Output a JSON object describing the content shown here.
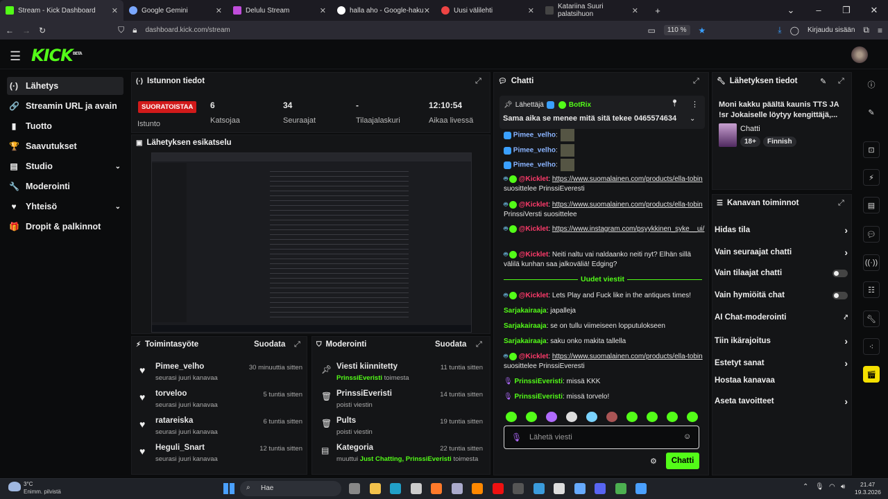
{
  "browser": {
    "tabs": [
      {
        "label": "Stream - Kick Dashboard",
        "color": "#53fc18"
      },
      {
        "label": "Google Gemini",
        "color": "#7aa7ff"
      },
      {
        "label": "Delulu Stream",
        "color": "#c04ddb"
      },
      {
        "label": "halla aho - Google-haku",
        "color": "#ffffff"
      },
      {
        "label": "Uusi välilehti",
        "color": "#e44"
      },
      {
        "label": "Katariina Suuri palatsihuon",
        "color": "#444"
      }
    ],
    "url": "dashboard.kick.com/stream",
    "zoom": "110 %",
    "signin": "Kirjaudu sisään"
  },
  "nav": [
    {
      "label": "Lähetys",
      "icon": "(·)"
    },
    {
      "label": "Streamin URL ja avain",
      "icon": "🔗"
    },
    {
      "label": "Tuotto",
      "icon": "▮"
    },
    {
      "label": "Saavutukset",
      "icon": "🏆"
    },
    {
      "label": "Studio",
      "icon": "▤"
    },
    {
      "label": "Moderointi",
      "icon": "🔧"
    },
    {
      "label": "Yhteisö",
      "icon": "♥"
    },
    {
      "label": "Dropit & palkinnot",
      "icon": "🎁"
    }
  ],
  "session": {
    "title": "Istunnon tiedot",
    "live": "SUORATOISTAA",
    "live_sub": "Istunto",
    "stats": [
      {
        "n": "6",
        "l": "Katsojaa"
      },
      {
        "n": "34",
        "l": "Seuraajat"
      },
      {
        "n": "-",
        "l": "Tilaajalaskuri"
      },
      {
        "n": "12:10:54",
        "l": "Aikaa livessä"
      }
    ]
  },
  "preview": {
    "title": "Lähetyksen esikatselu"
  },
  "activity": {
    "title": "Toimintasyöte",
    "filter": "Suodata",
    "rows": [
      {
        "name": "Pimee_velho",
        "sub": "seurasi juuri kanavaa",
        "time": "30 minuuttia sitten"
      },
      {
        "name": "torveloo",
        "sub": "seurasi juuri kanavaa",
        "time": "5 tuntia sitten"
      },
      {
        "name": "ratareiska",
        "sub": "seurasi juuri kanavaa",
        "time": "6 tuntia sitten"
      },
      {
        "name": "Heguli_Snart",
        "sub": "seurasi juuri kanavaa",
        "time": "12 tuntia sitten"
      }
    ]
  },
  "moderation": {
    "title": "Moderointi",
    "filter": "Suodata",
    "rows": [
      {
        "name": "Viesti kiinnitetty",
        "sub_user": "PrinssiEveristi",
        "sub": "toimesta",
        "time": "11 tuntia sitten",
        "icon": "pin"
      },
      {
        "name": "PrinssiEveristi",
        "sub": "poisti viestin",
        "time": "14 tuntia sitten",
        "icon": "trash"
      },
      {
        "name": "Pults",
        "sub": "poisti viestin",
        "time": "19 tuntia sitten",
        "icon": "trash"
      },
      {
        "name": "Kategoria",
        "sub": "muuttui",
        "cat": "Just Chatting,",
        "sub_user": "PrinssiEveristi",
        "sub2": "toimesta",
        "time": "22 tuntia sitten",
        "icon": "box"
      }
    ]
  },
  "chat": {
    "title": "Chatti",
    "pinned_label": "Lähettäjä",
    "pinned_user": "BotRix",
    "pinned_msg": "Sama aika se menee mitä sitä tekee 0465574634",
    "new_messages": "Uudet viestit",
    "input_placeholder": "Lähetä viesti",
    "send": "Chatti",
    "lines": [
      {
        "user": "Pimee_velho",
        "text": ":"
      },
      {
        "user": "Pimee_velho",
        "text": ":"
      },
      {
        "user": "Pimee_velho",
        "text": ":"
      },
      {
        "user": "@Kicklet",
        "text": "https://www.suomalainen.com/products/ella-tobin",
        "after": " suosittelee PrinssiEveresti"
      },
      {
        "user": "@Kicklet",
        "text": "https://www.suomalainen.com/products/ella-tobin",
        "after": " PrinssiVersti suosittelee"
      },
      {
        "user": "@Kicklet",
        "text": "https://www.instagram.com/psyykkinen_syke__ui/",
        "after": ""
      },
      {
        "user": "@Kicklet",
        "text": "Neiti naltu vai naldaanko neiti nyt? Elhän sillä välilä kunhan saa jalkoväliä! Edging?",
        "after": ""
      },
      {
        "user": "@Kicklet",
        "text": "Lets Play and Fuck like in the antiques times!",
        "after": ""
      },
      {
        "user": "Sarjakairaaja",
        "text": "japalleja"
      },
      {
        "user": "Sarjakairaaja",
        "text": "se on tullu viimeiseen lopputulokseen"
      },
      {
        "user": "Sarjakairaaja",
        "text": "saku onko makita tallella"
      },
      {
        "user": "@Kicklet",
        "text": "https://www.suomalainen.com/products/ella-tobin",
        "after": " suosittelee PrinssiEveresti"
      },
      {
        "user": "PrinssiEveristi",
        "text": "missä KKK"
      },
      {
        "user": "PrinssiEveristi",
        "text": "missä torvelo!"
      }
    ]
  },
  "stream_info": {
    "title": "Lähetyksen tiedot",
    "stream_title": "Moni kakku päältä kaunis TTS JA !sr Jokaiselle löytyy kengittäjä,...",
    "category": "Chatti",
    "tags": [
      "18+",
      "Finnish"
    ]
  },
  "channel_actions": {
    "title": "Kanavan toiminnot",
    "rows": [
      {
        "label": "Hidas tila",
        "ctl": "chev"
      },
      {
        "label": "Vain seuraajat chatti",
        "ctl": "chev"
      },
      {
        "label": "Vain tilaajat chatti",
        "ctl": "toggle"
      },
      {
        "label": "Vain hymiöitä chat",
        "ctl": "toggle"
      },
      {
        "label": "AI Chat-moderointi",
        "ctl": "ext"
      },
      {
        "label": "Tiin ikärajoitus",
        "ctl": "chev"
      },
      {
        "label": "Estetyt sanat",
        "ctl": "chev"
      },
      {
        "label": "Hostaa kanavaa",
        "ctl": ""
      },
      {
        "label": "Aseta tavoitteet",
        "ctl": "chev"
      }
    ]
  },
  "taskbar": {
    "weather_temp": "3°C",
    "weather_desc": "Enimm. pilvistä",
    "search": "Hae",
    "time": "21.47",
    "date": "19.3.2026"
  }
}
